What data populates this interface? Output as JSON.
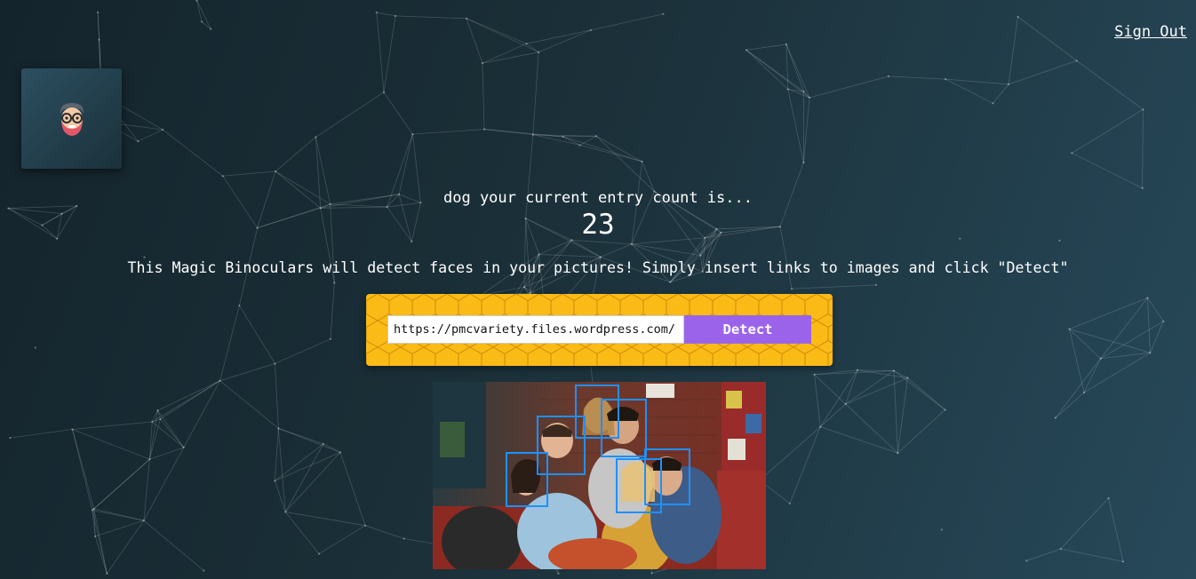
{
  "header": {
    "sign_out_label": "Sign Out"
  },
  "logo": {
    "icon": "nerd-face-icon"
  },
  "greeting": {
    "text": "dog your current entry count is...",
    "count": "23"
  },
  "description": "This Magic Binoculars will detect faces in your pictures! Simply insert links to images and click \"Detect\"",
  "form": {
    "url_value": "https://pmcvariety.files.wordpress.com/",
    "detect_label": "Detect"
  },
  "photo": {
    "faces_detected": 6
  },
  "colors": {
    "background_start": "#14242c",
    "background_end": "#27495a",
    "panel_yellow": "#fbbb16",
    "button_purple": "#9b63ea",
    "face_box_blue": "#1e90ff"
  }
}
